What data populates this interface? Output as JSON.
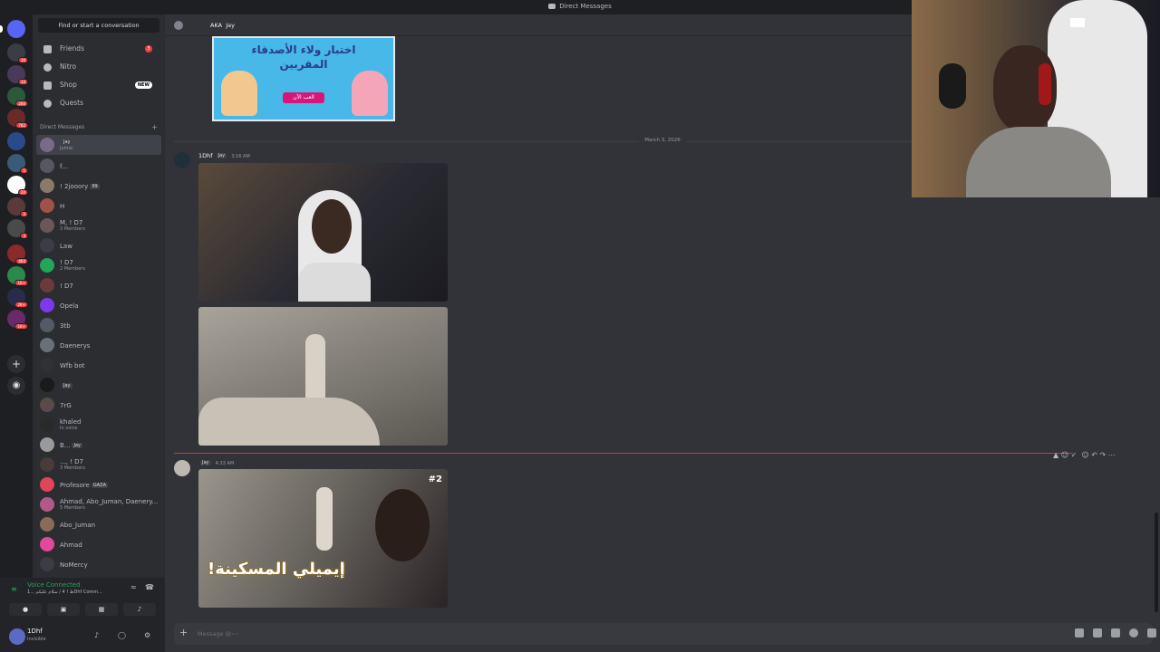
{
  "window": {
    "title": "Direct Messages"
  },
  "sidebar": {
    "search_label": "Find or start a conversation",
    "nav": [
      {
        "label": "Friends",
        "icon": "friends-icon",
        "count": "3"
      },
      {
        "label": "Nitro",
        "icon": "nitro-icon"
      },
      {
        "label": "Shop",
        "icon": "shop-icon",
        "badge": "NEW"
      },
      {
        "label": "Quests",
        "icon": "quests-icon"
      }
    ],
    "dm_header": "Direct Messages",
    "dms": [
      {
        "name": "",
        "tag": "Jay",
        "sub": "Jumia",
        "color": "#7a6a88",
        "active": true
      },
      {
        "name": "f...",
        "sub": "",
        "color": "#55585e"
      },
      {
        "name": "! 2jooory",
        "tag": "99",
        "sub": "",
        "color": "#8a7a6a"
      },
      {
        "name": "H",
        "sub": "",
        "color": "#a0524a"
      },
      {
        "name": "M, ! D7",
        "sub": "3 Members",
        "color": "#6a5858"
      },
      {
        "name": "Law",
        "sub": "",
        "color": "#3a3d44"
      },
      {
        "name": "! D7",
        "sub": "2 Members",
        "color": "#23a55a"
      },
      {
        "name": "! D7",
        "sub": "",
        "color": "#6b3a3a"
      },
      {
        "name": "Opela",
        "sub": "",
        "color": "#7c3aed"
      },
      {
        "name": "3tb",
        "sub": "",
        "color": "#555b66"
      },
      {
        "name": "Daenerys",
        "sub": "",
        "color": "#6a6f78"
      },
      {
        "name": "Wfb bot",
        "sub": "",
        "color": "#2f3136"
      },
      {
        "name": "",
        "tag": "Jay",
        "sub": "",
        "color": "#1a1a1a"
      },
      {
        "name": "7rG",
        "sub": "",
        "color": "#5a4a4a"
      },
      {
        "name": "khaled",
        "sub": "In voice",
        "color": "#2a2a2a"
      },
      {
        "name": "B...",
        "tag": "Jay",
        "sub": "",
        "color": "#9a9a9a"
      },
      {
        "name": "..., ! D7",
        "sub": "3 Members",
        "color": "#4a3a3a"
      },
      {
        "name": "Profesore",
        "tag": "GAZA",
        "sub": "",
        "color": "#e0455a"
      },
      {
        "name": "Ahmad, Abo_Juman, Daenery...",
        "sub": "5 Members",
        "color": "#b05a8a"
      },
      {
        "name": "Abo_Juman",
        "sub": "",
        "color": "#8a6a58"
      },
      {
        "name": "Ahmad",
        "sub": "",
        "color": "#e04a9a"
      },
      {
        "name": "NoMercy",
        "sub": "",
        "color": "#3a3d44"
      }
    ]
  },
  "voice": {
    "status": "Voice Connected",
    "location": "ظ ! 4 / سلام عليكم ...1Dhf Comm..."
  },
  "user": {
    "name": "1Dhf",
    "status": "Invisible"
  },
  "chat": {
    "header_name": "Jay",
    "header_prefix": "AKA",
    "banner_line1": "اختبار ولاء الأصدقاء",
    "banner_line2": "المقربين",
    "banner_button": "العب الآن",
    "date_divider": "March 3, 2026",
    "msg1": {
      "author": "1Dhf",
      "tag": "Jay",
      "time": "3:16 AM"
    },
    "msg2": {
      "author": "",
      "tag": "Jay",
      "time": "4:33 AM",
      "overlay_number": "#2",
      "caption": "إيميلي المسكينة!"
    },
    "composer_placeholder": "Message @~‹"
  },
  "colors": {
    "accent": "#5865f2",
    "online": "#23a55a",
    "danger": "#f23f43"
  }
}
